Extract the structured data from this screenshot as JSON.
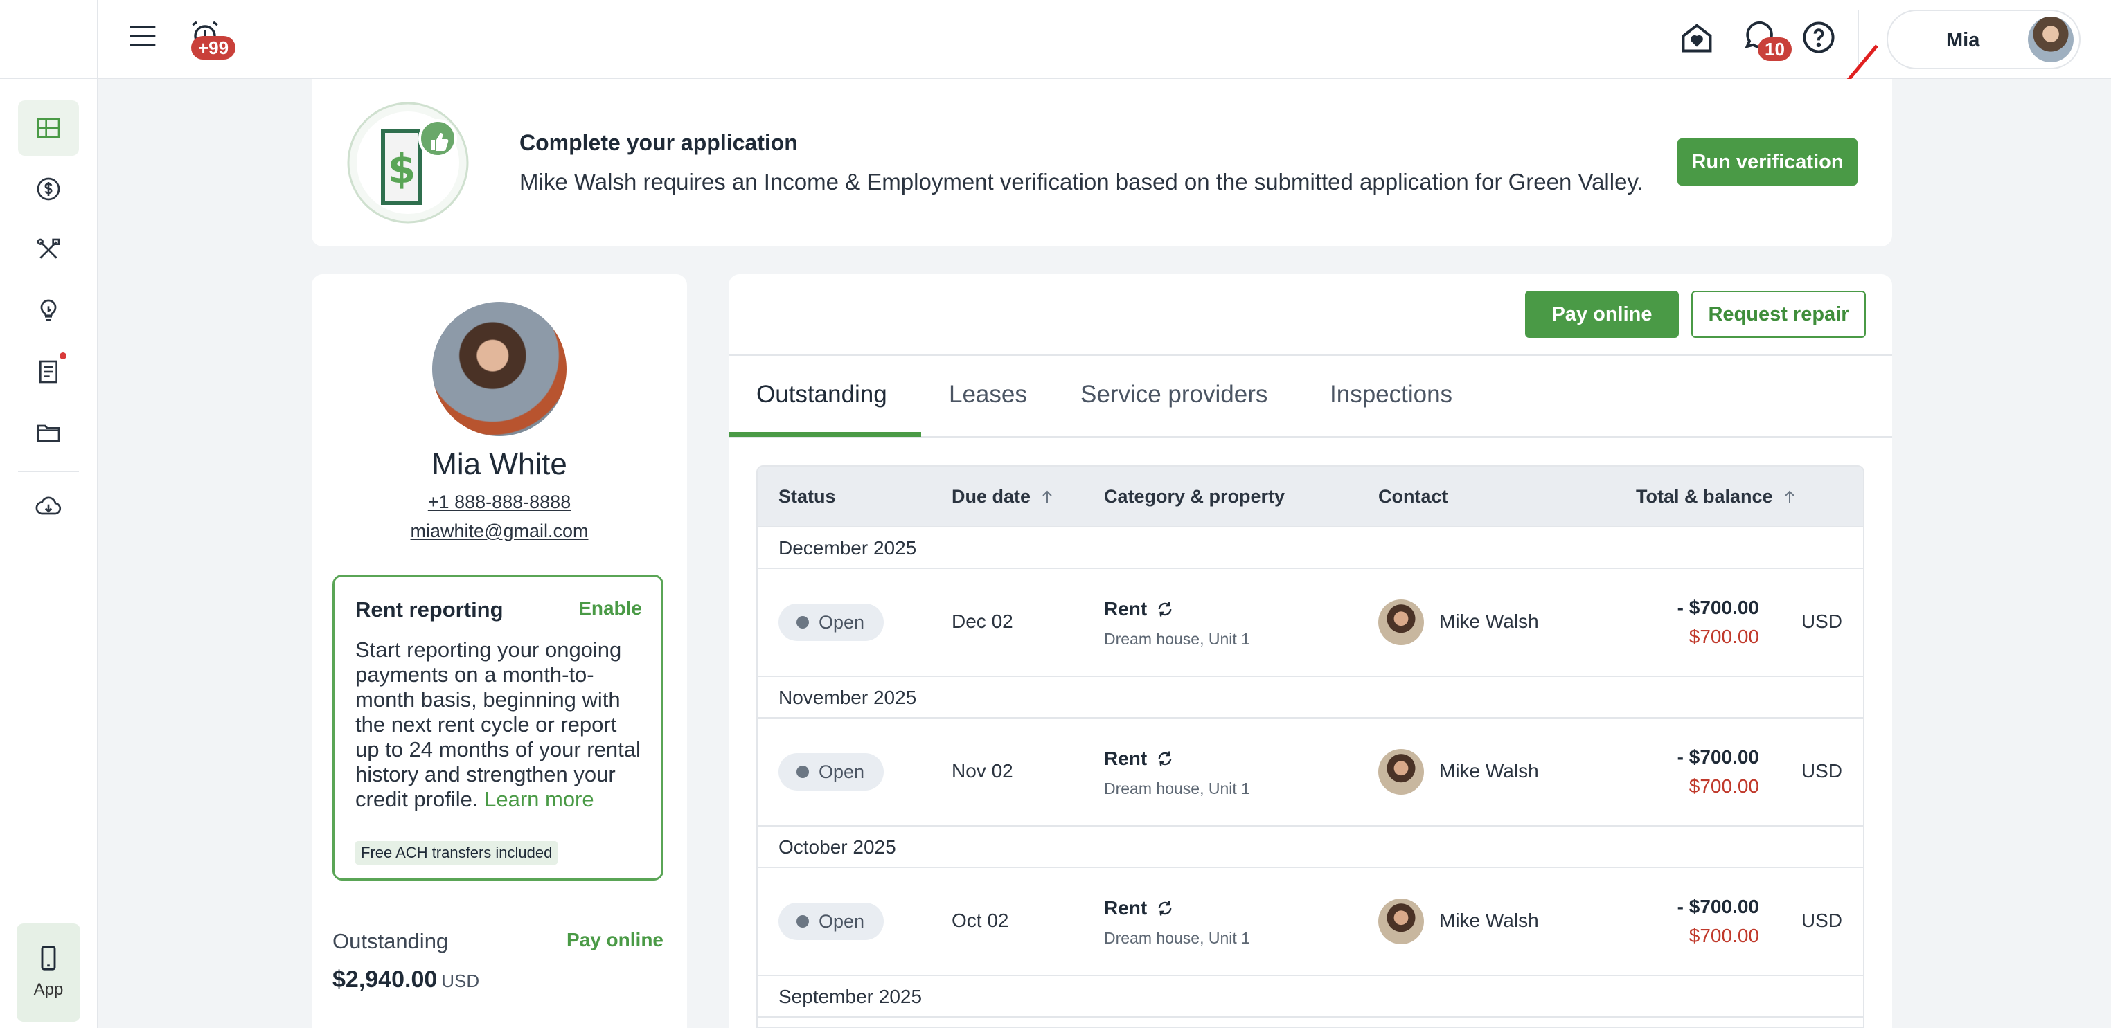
{
  "topbar": {
    "alarm_badge": "+99",
    "messages_badge": "10",
    "user_name": "Mia"
  },
  "sidebar": {
    "app_label": "App"
  },
  "banner": {
    "title": "Complete your application",
    "text": "Mike Walsh requires an Income & Employment verification based on the submitted application for Green Valley.",
    "button": "Run verification"
  },
  "profile": {
    "name": "Mia White",
    "phone": "+1 888-888-8888",
    "email": "miawhite@gmail.com",
    "rent_reporting": {
      "title": "Rent reporting",
      "action": "Enable",
      "description": "Start reporting your ongoing payments on a month-to-month basis, beginning with the next rent cycle or report up to 24 months of your rental history and strengthen your credit profile.",
      "learn_more": "Learn more",
      "tag": "Free ACH transfers included"
    },
    "outstanding": {
      "label": "Outstanding",
      "action": "Pay online",
      "amount": "$2,940.00",
      "currency": "USD"
    }
  },
  "main": {
    "pay_online": "Pay online",
    "request_repair": "Request repair",
    "tabs": [
      "Outstanding",
      "Leases",
      "Service providers",
      "Inspections"
    ],
    "table": {
      "headers": [
        "Status",
        "Due date",
        "Category & property",
        "Contact",
        "Total & balance"
      ],
      "groups": [
        {
          "month": "December 2025",
          "row": {
            "status": "Open",
            "due": "Dec 02",
            "category": "Rent",
            "property": "Dream house, Unit 1",
            "contact": "Mike Walsh",
            "total": "- $700.00",
            "balance": "$700.00",
            "currency": "USD"
          }
        },
        {
          "month": "November 2025",
          "row": {
            "status": "Open",
            "due": "Nov 02",
            "category": "Rent",
            "property": "Dream house, Unit 1",
            "contact": "Mike Walsh",
            "total": "- $700.00",
            "balance": "$700.00",
            "currency": "USD"
          }
        },
        {
          "month": "October 2025",
          "row": {
            "status": "Open",
            "due": "Oct 02",
            "category": "Rent",
            "property": "Dream house, Unit 1",
            "contact": "Mike Walsh",
            "total": "- $700.00",
            "balance": "$700.00",
            "currency": "USD"
          }
        },
        {
          "month": "September 2025"
        }
      ]
    }
  },
  "colors": {
    "brand_green": "#4a9a46",
    "badge_red": "#c9403a",
    "balance_red": "#c0392b",
    "arrow_red": "#e02020"
  },
  "icons": [
    "dashboard-icon",
    "dollar-icon",
    "tools-icon",
    "lightbulb-icon",
    "document-icon",
    "folder-icon",
    "cloud-download-icon",
    "phone-icon",
    "hamburger-icon",
    "alarm-icon",
    "home-heart-icon",
    "chat-icon",
    "help-icon",
    "refresh-icon",
    "sort-up-icon"
  ]
}
